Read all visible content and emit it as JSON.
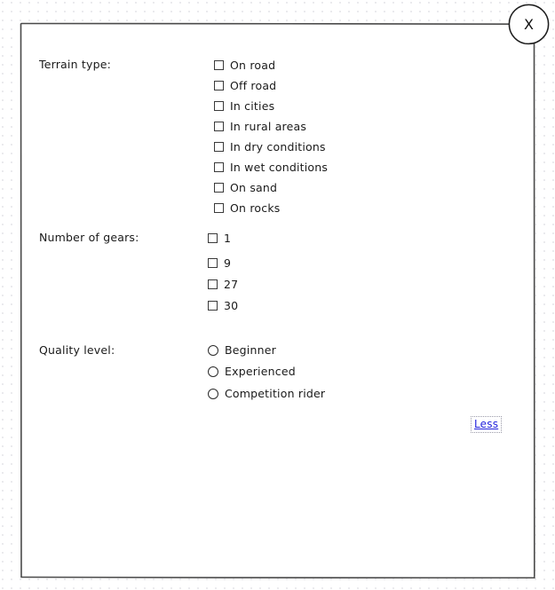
{
  "dialog": {
    "close_label": "X",
    "close_icon": "close-x-icon"
  },
  "groups": [
    {
      "id": "terrain-type",
      "label": "Terrain type:",
      "control": "checkbox",
      "options": [
        {
          "label": "On road",
          "checked": false
        },
        {
          "label": "Off road",
          "checked": false
        },
        {
          "label": "In cities",
          "checked": false
        },
        {
          "label": "In rural areas",
          "checked": false
        },
        {
          "label": "In dry conditions",
          "checked": false
        },
        {
          "label": "In wet conditions",
          "checked": false
        },
        {
          "label": "On sand",
          "checked": false
        },
        {
          "label": "On rocks",
          "checked": false
        }
      ]
    },
    {
      "id": "number-of-gears",
      "label": "Number of gears:",
      "control": "checkbox",
      "options": [
        {
          "label": "1",
          "checked": false
        },
        {
          "label": "9",
          "checked": false
        },
        {
          "label": "27",
          "checked": false
        },
        {
          "label": "30",
          "checked": false
        }
      ]
    },
    {
      "id": "quality-level",
      "label": "Quality level:",
      "control": "radio",
      "options": [
        {
          "label": "Beginner",
          "checked": false
        },
        {
          "label": "Experienced",
          "checked": false
        },
        {
          "label": "Competition rider",
          "checked": false
        }
      ]
    }
  ],
  "disclosure": {
    "label": "Less"
  },
  "colors": {
    "link": "#2222dd",
    "border": "#3a3a3a",
    "text": "#1a1a1a",
    "grid_dot": "#e9e9ec"
  }
}
